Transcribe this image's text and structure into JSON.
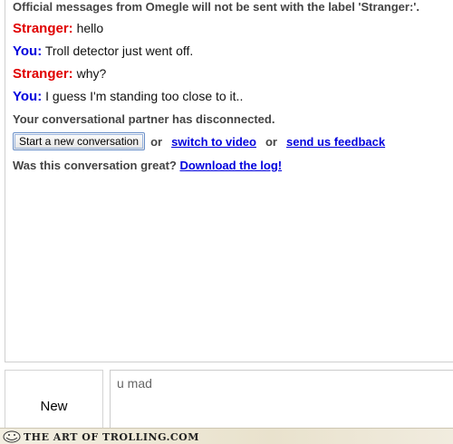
{
  "log": {
    "official_notice": "Official messages from Omegle will not be sent with the label 'Stranger:'.",
    "messages": [
      {
        "speaker": "Stranger:",
        "text": "hello"
      },
      {
        "speaker": "You:",
        "text": "Troll detector just went off."
      },
      {
        "speaker": "Stranger:",
        "text": "why?"
      },
      {
        "speaker": "You:",
        "text": "I guess I'm standing too close to it.."
      }
    ],
    "disconnect_notice": "Your conversational partner has disconnected.",
    "actions": {
      "new_conversation_label": "Start a new conversation",
      "or_1": "or",
      "switch_video_label": "switch to video",
      "or_2": "or",
      "feedback_label": "send us feedback"
    },
    "great_prompt": "Was this conversation great?",
    "download_log_label": "Download the log!"
  },
  "bottom": {
    "new_button_label": "New",
    "input_value": "u mad"
  },
  "watermark": {
    "text": "The Art of Trolling.com"
  },
  "colors": {
    "stranger": "#e00000",
    "you": "#0000dd",
    "link": "#0000dd"
  }
}
